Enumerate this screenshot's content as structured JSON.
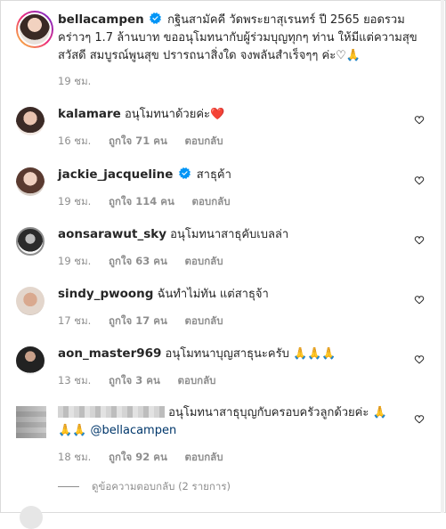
{
  "caption": {
    "username": "bellacampen",
    "text": "กฐินสามัคคี วัดพระยาสุเรนทร์ ปี 2565 ยอดรวมคร่าวๆ 1.7 ล้านบาท ขออนุโมทนากับผู้ร่วมบุญทุกๆ ท่าน ให้มีแต่ความสุขสวัสดี สมบูรณ์พูนสุข ปรารถนาสิ่งใด จงพลันสำเร็จๆๆ ค่ะ♡🙏",
    "time": "19 ชม."
  },
  "comments": [
    {
      "username": "kalamare",
      "verified": false,
      "text": "อนุโมทนาด้วยค่ะ",
      "emoji": "❤️",
      "time": "16 ชม.",
      "likes": "ถูกใจ 71 คน",
      "reply": "ตอบกลับ"
    },
    {
      "username": "jackie_jacqueline",
      "verified": true,
      "text": "สาธุค้า",
      "emoji": "",
      "time": "19 ชม.",
      "likes": "ถูกใจ 114 คน",
      "reply": "ตอบกลับ"
    },
    {
      "username": "aonsarawut_sky",
      "verified": false,
      "text": "อนุโมทนาสาธุคับเบลล่า",
      "emoji": "",
      "time": "19 ชม.",
      "likes": "ถูกใจ 63 คน",
      "reply": "ตอบกลับ"
    },
    {
      "username": "sindy_pwoong",
      "verified": false,
      "text": "ฉันทำไม่ทัน แต่สาธุจ้า",
      "emoji": "",
      "time": "17 ชม.",
      "likes": "ถูกใจ 17 คน",
      "reply": "ตอบกลับ"
    },
    {
      "username": "aon_master969",
      "verified": false,
      "text": "อนุโมทนาบุญสาธุนะครับ",
      "emoji": "🙏🙏🙏",
      "time": "13 ชม.",
      "likes": "ถูกใจ 3 คน",
      "reply": "ตอบกลับ"
    },
    {
      "username": "",
      "verified": false,
      "text": "อนุโมทนาสาธุบุญกับครอบครัวลูกด้วยค่ะ 🙏",
      "line2": "🙏🙏 @bellacampen",
      "emoji": "",
      "time": "18 ชม.",
      "likes": "ถูกใจ 92 คน",
      "reply": "ตอบกลับ"
    }
  ],
  "view_replies": "ดูข้อความตอบกลับ (2 รายการ)",
  "colors": {
    "verified": "#0095f6",
    "heart_red": "#ed4956",
    "muted": "#8e8e8e"
  }
}
